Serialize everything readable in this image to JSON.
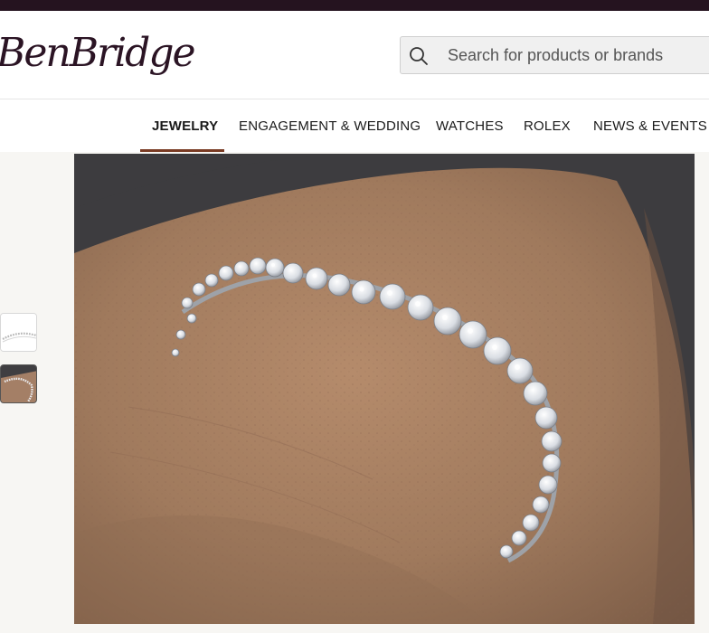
{
  "brand": {
    "logo_text": "BenBridge",
    "accent": "#25131f"
  },
  "search": {
    "placeholder": "Search for products or brands",
    "value": ""
  },
  "nav": {
    "items": [
      {
        "label": "JEWELRY",
        "active": true
      },
      {
        "label": "ENGAGEMENT & WEDDING",
        "active": false
      },
      {
        "label": "WATCHES",
        "active": false
      },
      {
        "label": "ROLEX",
        "active": false
      },
      {
        "label": "NEWS & EVENTS",
        "active": false
      }
    ],
    "underline_color": "#7a3b24"
  },
  "product": {
    "thumbnails": [
      {
        "icon": "bracelet-flat-thumbnail"
      },
      {
        "icon": "bracelet-on-wrist-thumbnail"
      }
    ],
    "main_image": {
      "icon": "diamond-tennis-bracelet-on-wrist-photo"
    }
  }
}
